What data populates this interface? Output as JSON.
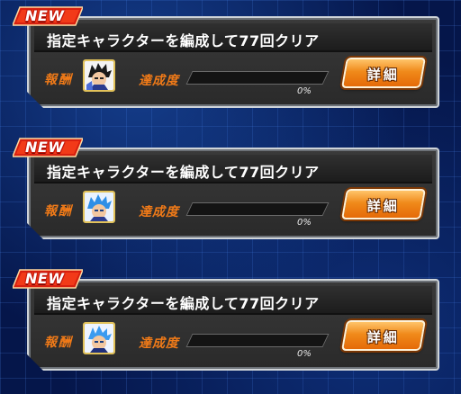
{
  "colors": {
    "background": "#05164a",
    "accent_orange": "#f07a18",
    "new_tag_red": "#d8200f",
    "panel": "#2d2d2d"
  },
  "missions": [
    {
      "new_label": "NEW",
      "title": "指定キャラクターを編成して77回クリア",
      "reward_label": "報酬",
      "reward_icon": "character-portrait-black-hair-icon",
      "progress_label": "達成度",
      "progress_fraction": 0,
      "progress_text": "0%",
      "detail_label": "詳細"
    },
    {
      "new_label": "NEW",
      "title": "指定キャラクターを編成して77回クリア",
      "reward_label": "報酬",
      "reward_icon": "character-portrait-blue-hair-icon",
      "progress_label": "達成度",
      "progress_fraction": 0,
      "progress_text": "0%",
      "detail_label": "詳細"
    },
    {
      "new_label": "NEW",
      "title": "指定キャラクターを編成して77回クリア",
      "reward_label": "報酬",
      "reward_icon": "character-portrait-blue-hair-icon",
      "progress_label": "達成度",
      "progress_fraction": 0,
      "progress_text": "0%",
      "detail_label": "詳細"
    }
  ]
}
